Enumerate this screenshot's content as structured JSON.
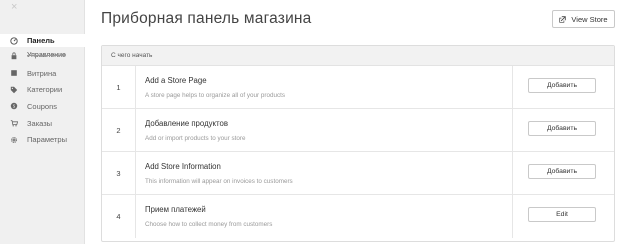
{
  "sidebar": {
    "close_glyph": "×",
    "items": [
      {
        "label": "Панель",
        "icon": "dashboard-icon",
        "active": true
      },
      {
        "label": "",
        "icon": "store-icon",
        "active": false
      },
      {
        "label": "Витрина",
        "icon": "storefront-icon",
        "active": false
      },
      {
        "label": "Категории",
        "icon": "tag-icon",
        "active": false
      },
      {
        "label": "Coupons",
        "icon": "coupon-icon",
        "active": false
      },
      {
        "label": "Заказы",
        "icon": "cart-icon",
        "active": false
      },
      {
        "label": "Параметры",
        "icon": "gear-icon",
        "active": false
      }
    ],
    "sub_label": "Управление"
  },
  "header": {
    "title": "Приборная панель магазина",
    "view_store_label": "View Store",
    "view_store_icon": "external-link-icon"
  },
  "card": {
    "heading": "С чего начать",
    "steps": [
      {
        "num": "1",
        "title": "Add a Store Page",
        "desc": "A store page helps to organize all of your products",
        "button": "Добавить"
      },
      {
        "num": "2",
        "title": "Добавление продуктов",
        "desc": "Add or import products to your store",
        "button": "Добавить"
      },
      {
        "num": "3",
        "title": "Add Store Information",
        "desc": "This information will appear on invoices to customers",
        "button": "Добавить"
      },
      {
        "num": "4",
        "title": "Прием платежей",
        "desc": "Choose how to collect money from customers",
        "button": "Edit"
      }
    ]
  },
  "colors": {
    "sidebar_bg": "#f0f0f0",
    "card_header_bg": "#f2f2f2",
    "border": "#dddddd",
    "text": "#333333",
    "muted": "#9a9a9a"
  }
}
